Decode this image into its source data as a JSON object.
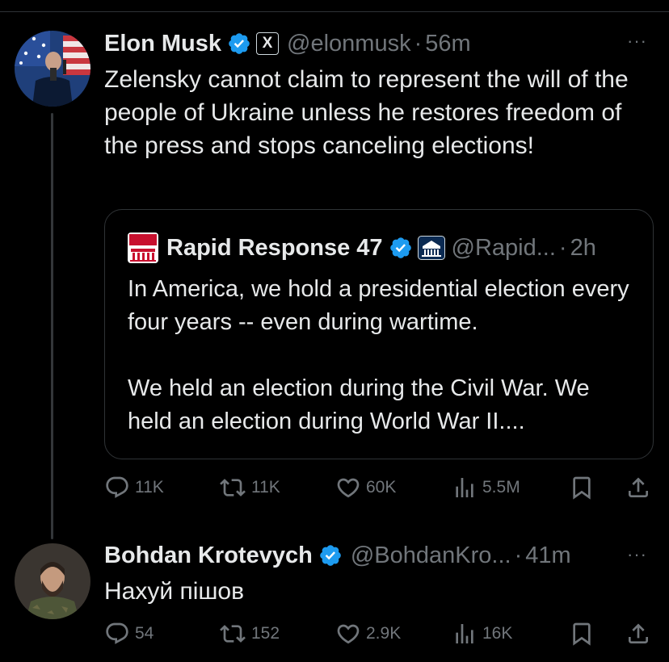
{
  "tweets": [
    {
      "author": {
        "name": "Elon Musk",
        "handle": "@elonmusk",
        "org_badge": "X",
        "verified": true,
        "avatar_icon": "elon-musk-avatar"
      },
      "separator": "·",
      "time": "56m",
      "text": "Zelensky cannot claim to represent the will of the people of Ukraine unless he restores freedom of the press and stops canceling elections!",
      "quote": {
        "author": {
          "name": "Rapid Response 47",
          "handle": "@Rapid...",
          "verified": true,
          "avatar_icon": "rapid-response-logo",
          "org_icon": "white-house-icon"
        },
        "separator": "·",
        "time": "2h",
        "paragraphs": [
          "In America, we hold a presidential election every four years -- even during wartime.",
          "We held an election during the Civil War. We held an election during World War II...."
        ]
      },
      "stats": {
        "replies": "11K",
        "reposts": "11K",
        "likes": "60K",
        "views": "5.5M"
      }
    },
    {
      "author": {
        "name": "Bohdan Krotevych",
        "handle": "@BohdanKro...",
        "verified": true,
        "avatar_icon": "bohdan-avatar"
      },
      "separator": "·",
      "time": "41m",
      "text": "Нахуй пішов",
      "stats": {
        "replies": "54",
        "reposts": "152",
        "likes": "2.9K",
        "views": "16K"
      }
    }
  ],
  "more_label": "···",
  "colors": {
    "background": "#000000",
    "text": "#e7e9ea",
    "muted": "#71767b",
    "verified": "#1d9bf0",
    "border": "#2f3336"
  },
  "icons": [
    "reply-icon",
    "repost-icon",
    "like-icon",
    "views-icon",
    "bookmark-icon",
    "share-icon",
    "verified-badge-icon",
    "more-icon"
  ]
}
